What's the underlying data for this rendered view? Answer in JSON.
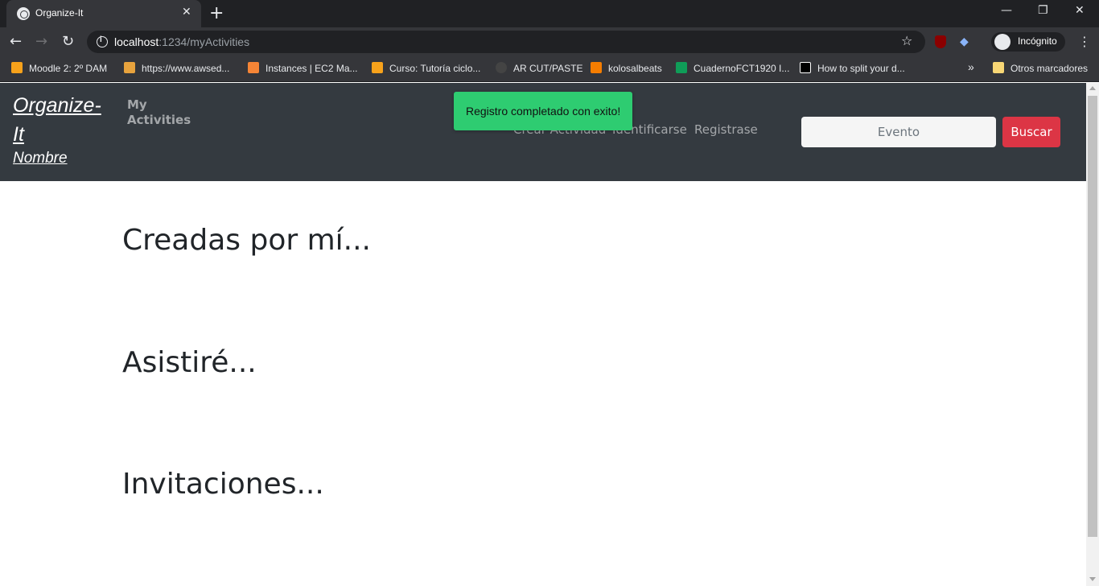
{
  "browser": {
    "tab_title": "Organize-It",
    "url_host": "localhost",
    "url_path": ":1234/myActivities",
    "profile_label": "Incógnito",
    "bookmarks": [
      {
        "label": "Moodle 2: 2º DAM",
        "icon_color": "#f7a21b"
      },
      {
        "label": "https://www.awsed...",
        "icon_color": "#e8a33d"
      },
      {
        "label": "Instances | EC2 Ma...",
        "icon_color": "#f58536"
      },
      {
        "label": "Curso: Tutoría ciclo...",
        "icon_color": "#f7a21b"
      },
      {
        "label": "AR CUT/PASTE",
        "icon_color": "#444444"
      },
      {
        "label": "kolosalbeats",
        "icon_color": "#f57d00"
      },
      {
        "label": "CuadernoFCT1920 I...",
        "icon_color": "#0f9d58"
      },
      {
        "label": "How to split your d...",
        "icon_color": "#000000"
      }
    ],
    "bookmarks_overflow": "»",
    "other_bookmarks": "Otros marcadores"
  },
  "navbar": {
    "brand_title": "Organize-It",
    "brand_user": "Nombre",
    "my_activities": "My Activities",
    "links": [
      "Crear Actividad",
      "Identificarse",
      "Registrase"
    ],
    "search_placeholder": "Evento",
    "search_button": "Buscar"
  },
  "toast": {
    "message": "Registro completado con exito!",
    "color": "#2ecc71"
  },
  "sections": {
    "created": "Creadas por mí...",
    "attending": "Asistiré...",
    "invitations": "Invitaciones..."
  },
  "colors": {
    "navbar_bg": "#343a40",
    "search_button_bg": "#dc3545"
  }
}
